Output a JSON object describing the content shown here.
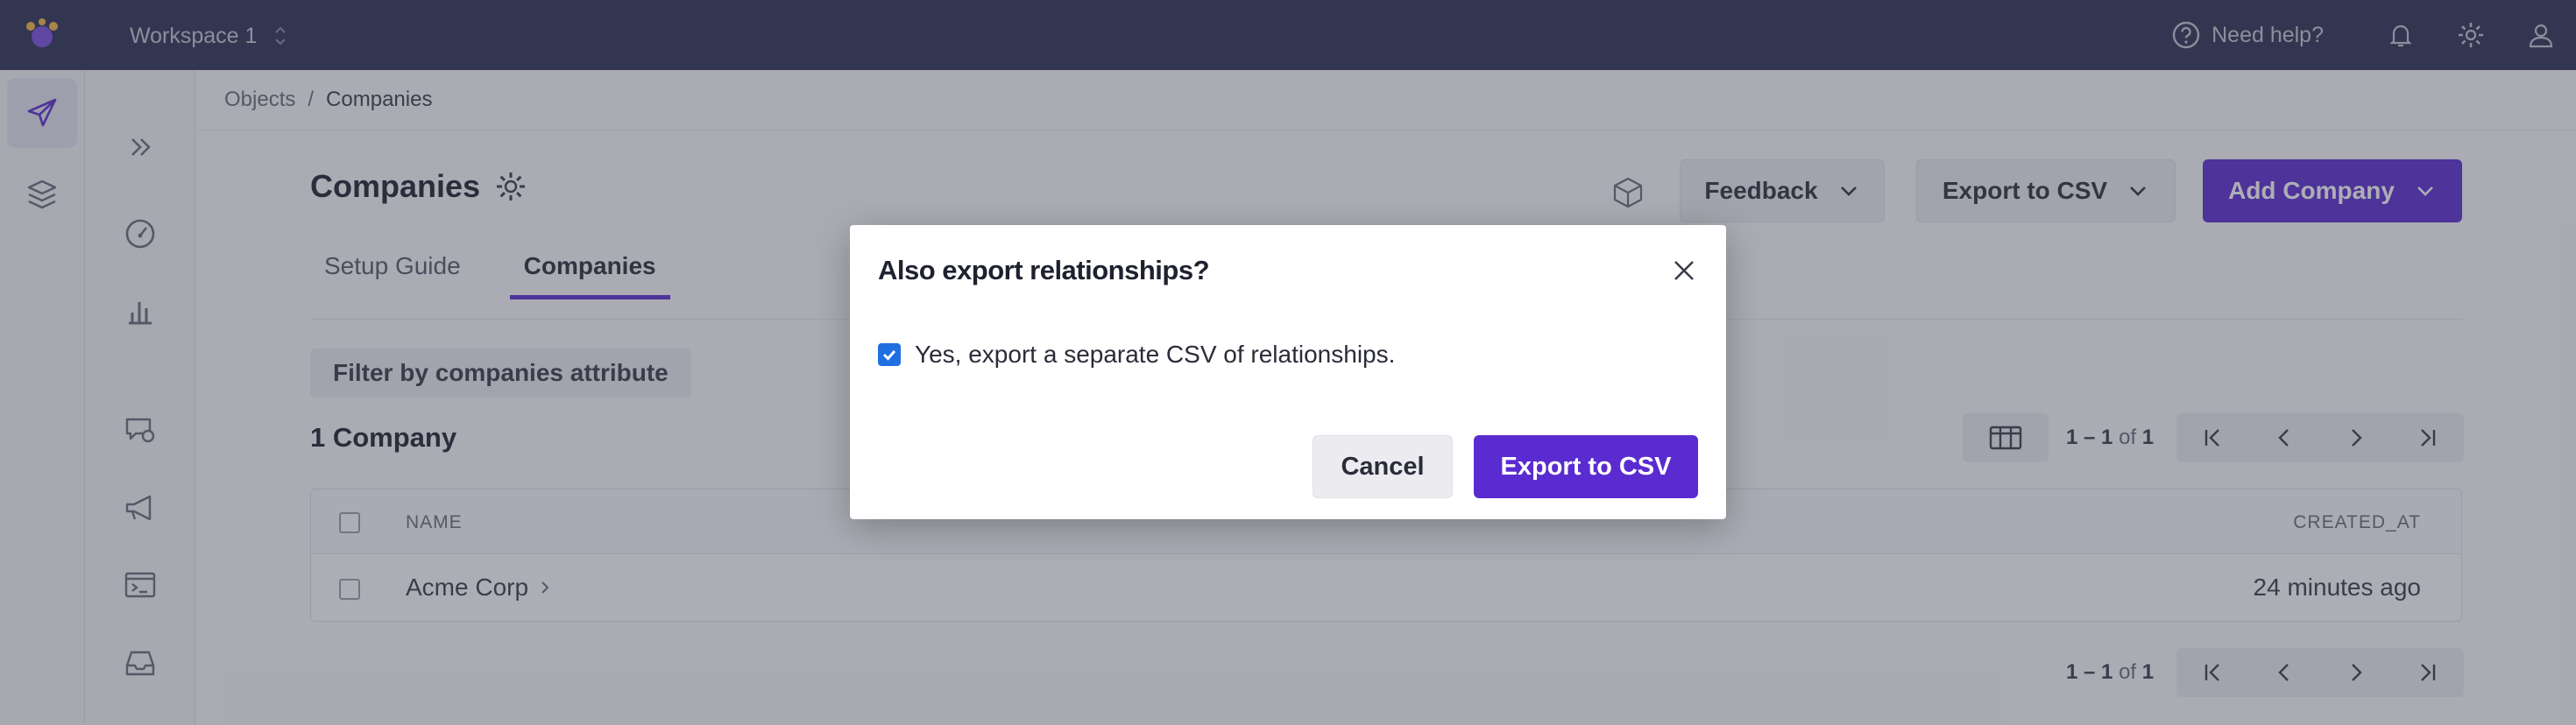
{
  "topbar": {
    "workspace": "Workspace 1",
    "help_label": "Need help?"
  },
  "breadcrumb": {
    "root": "Objects",
    "separator": "/",
    "current": "Companies"
  },
  "page": {
    "title": "Companies",
    "feedback_label": "Feedback",
    "export_label": "Export to CSV",
    "add_label": "Add Company",
    "tabs": [
      {
        "label": "Setup Guide",
        "active": false
      },
      {
        "label": "Companies",
        "active": true
      }
    ],
    "filter_label": "Filter by companies attribute",
    "count_label": "1 Company",
    "pagination": {
      "range": "1 – 1",
      "of": "of",
      "total": "1"
    }
  },
  "table": {
    "columns": [
      "NAME",
      "CREATED_AT"
    ],
    "rows": [
      {
        "name": "Acme Corp",
        "created_at": "24 minutes ago"
      }
    ]
  },
  "modal": {
    "title": "Also export relationships?",
    "checkbox_label": "Yes, export a separate CSV of relationships.",
    "checkbox_checked": true,
    "cancel_label": "Cancel",
    "confirm_label": "Export to CSV"
  },
  "colors": {
    "topbar": "#2e3152",
    "accent": "#5a2bd0",
    "checkbox": "#1f6fe0"
  },
  "icons": {
    "rail": [
      "paper-plane-icon",
      "layers-icon"
    ],
    "nav": [
      "expand-icon",
      "dashboard-icon",
      "bar-chart-icon",
      "chat-icon",
      "megaphone-icon",
      "terminal-icon",
      "inbox-icon"
    ],
    "top": [
      "help-icon",
      "bell-icon",
      "gear-icon",
      "user-icon"
    ]
  }
}
